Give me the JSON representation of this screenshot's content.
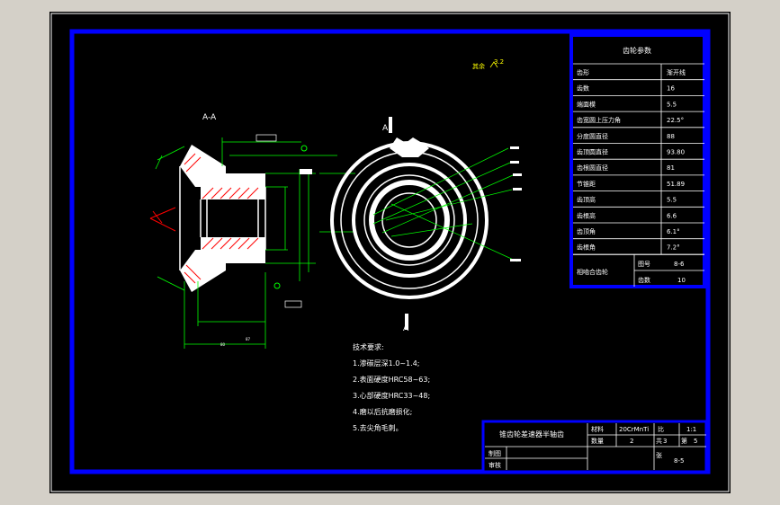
{
  "view": {
    "section_label": "A-A",
    "cut_mark_left": "A",
    "cut_mark_right": "A",
    "surface_finish": "其余",
    "surface_finish_value": "3.2"
  },
  "params_table": {
    "title": "齿轮参数",
    "rows": [
      {
        "name": "齿形",
        "value": "渐开线"
      },
      {
        "name": "齿数",
        "value": "16"
      },
      {
        "name": "端面模",
        "value": "5.5"
      },
      {
        "name": "齿宽圆上压力角",
        "value": "22.5°"
      },
      {
        "name": "分度圆直径",
        "value": "88"
      },
      {
        "name": "齿顶圆直径",
        "value": "93.80"
      },
      {
        "name": "齿根圆直径",
        "value": "81"
      },
      {
        "name": "节锥距",
        "value": "51.89"
      },
      {
        "name": "齿顶高",
        "value": "5.5"
      },
      {
        "name": "齿根高",
        "value": "6.6"
      },
      {
        "name": "齿顶角",
        "value": "6.1°"
      },
      {
        "name": "齿根角",
        "value": "7.2°"
      }
    ],
    "mating_label": "相啮合齿轮",
    "mating_code_label": "图号",
    "mating_code_value": "8-6",
    "mating_teeth_label": "齿数",
    "mating_teeth_value": "10"
  },
  "tech_notes": {
    "title": "技术要求:",
    "items": [
      "1.渗碳层深1.0~1.4;",
      "2.表面硬度HRC58~63;",
      "3.心部硬度HRC33~48;",
      "4.磨以后抗磨损化;",
      "5.去尖角毛刺。"
    ]
  },
  "title_block": {
    "part_name": "锥齿轮差速器半轴齿",
    "material_label": "材料",
    "material_value": "20CrMnTi",
    "scale_label": "比",
    "scale_value": "1:1",
    "qty_label": "数量",
    "qty_value": "2",
    "sheet_label": "共",
    "sheet_total": "3",
    "sheet_no_label": "第",
    "sheet_no": "5",
    "drawing_no_label": "张",
    "drawing_no": "8-5",
    "draw_label": "制图",
    "review_label": "审核"
  },
  "colors": {
    "background": "#000000",
    "outer_frame": "#ffffff",
    "inner_frame": "#0000ff",
    "text": "#ffffff",
    "dimension": "#00ff00",
    "cutting_line": "#ff0000",
    "surface_mark": "#ffff00"
  }
}
